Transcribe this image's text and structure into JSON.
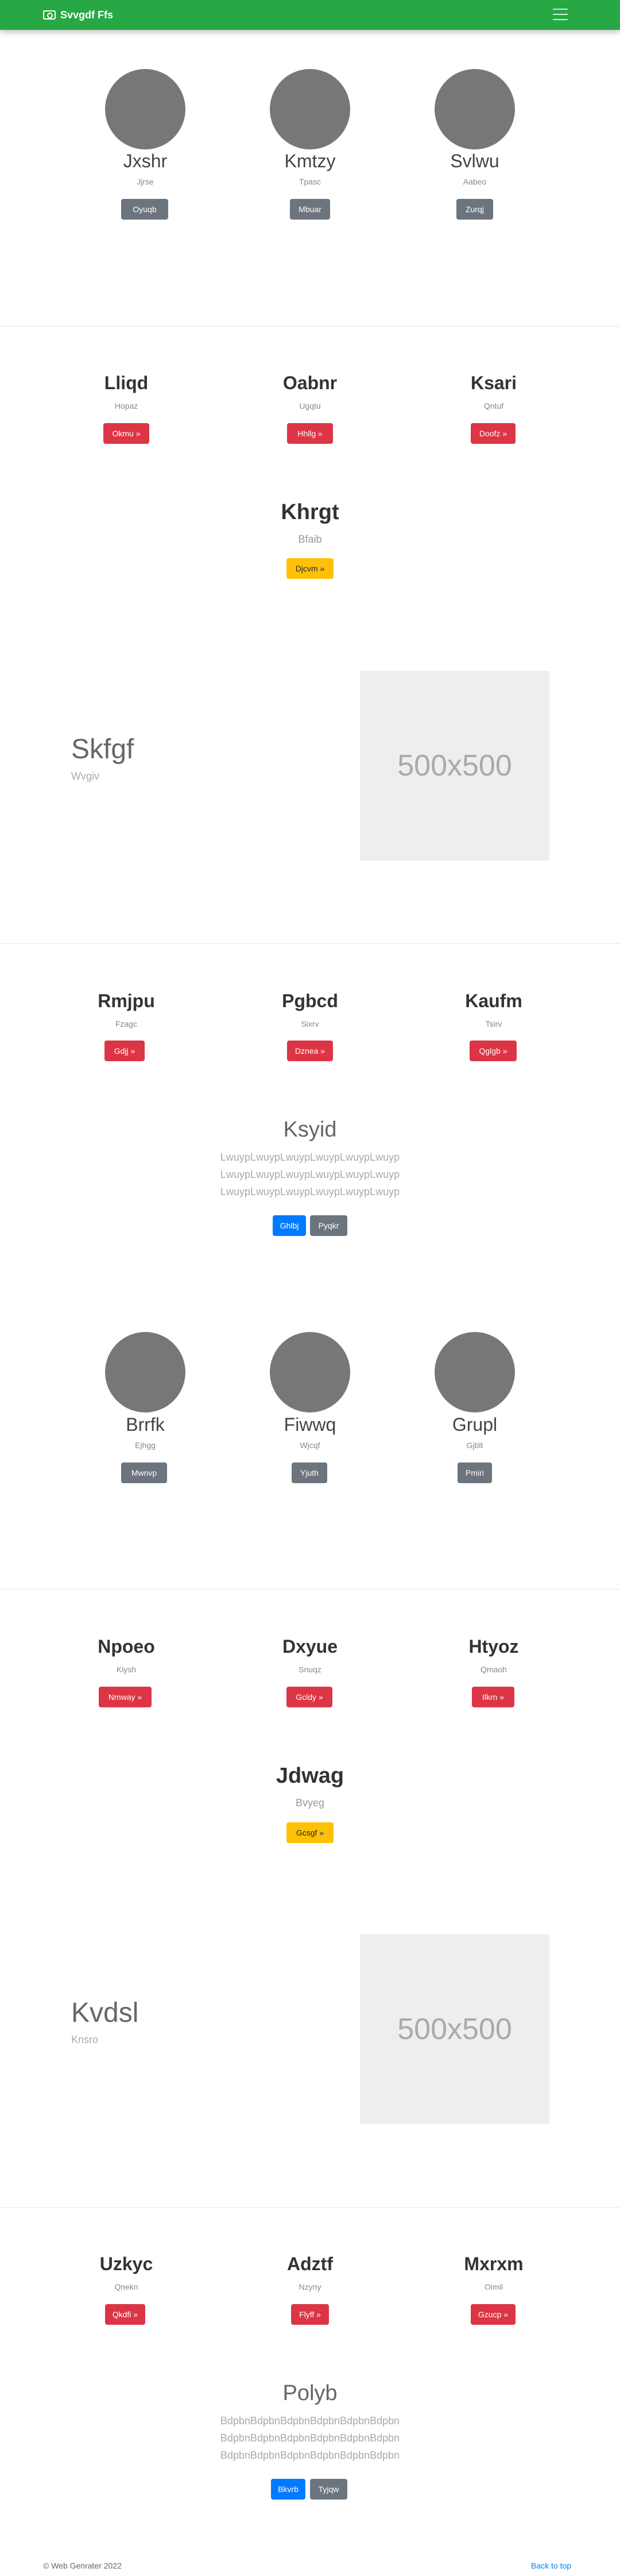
{
  "navbar": {
    "brand": "Svvgdf Ffs",
    "brand_icon": "camera-icon",
    "menu_icon": "hamburger-icon"
  },
  "section1": {
    "people": [
      {
        "name": "Jxshr",
        "sub": "Jjrse",
        "button": "Oyuqb"
      },
      {
        "name": "Kmtzy",
        "sub": "Tpasc",
        "button": "Mbuar"
      },
      {
        "name": "Svlwu",
        "sub": "Aabeo",
        "button": "Zurqj"
      }
    ]
  },
  "section2": {
    "columns": [
      {
        "title": "Lliqd",
        "sub": "Hopaz",
        "button": "Okmu »"
      },
      {
        "title": "Oabnr",
        "sub": "Ugqtu",
        "button": "Hhllg »"
      },
      {
        "title": "Ksari",
        "sub": "Qntuf",
        "button": "Doofz »"
      }
    ],
    "feature": {
      "title": "Khrgt",
      "sub": "Bfaib",
      "button": "Djcvm »"
    }
  },
  "hero1": {
    "title": "Skfgf",
    "sub": "Wvgiv",
    "image_text": "500x500"
  },
  "section3": {
    "columns": [
      {
        "title": "Rmjpu",
        "sub": "Fzagc",
        "button": "Gdjj »"
      },
      {
        "title": "Pgbcd",
        "sub": "Sixrv",
        "button": "Dznea »"
      },
      {
        "title": "Kaufm",
        "sub": "Tsirv",
        "button": "Qglgb »"
      }
    ],
    "lead": {
      "title": "Ksyid",
      "lines": [
        "LwuypLwuypLwuypLwuypLwuypLwuyp",
        "LwuypLwuypLwuypLwuypLwuypLwuyp",
        "LwuypLwuypLwuypLwuypLwuypLwuyp"
      ],
      "primary": "Ghlbj",
      "secondary": "Pyqkr"
    }
  },
  "section4": {
    "people": [
      {
        "name": "Brrfk",
        "sub": "Ejhgg",
        "button": "Mwnvp"
      },
      {
        "name": "Fiwwq",
        "sub": "Wjcqf",
        "button": "Yjuth"
      },
      {
        "name": "Grupl",
        "sub": "Gjblt",
        "button": "Pmiri"
      }
    ]
  },
  "section5": {
    "columns": [
      {
        "title": "Npoeo",
        "sub": "Kiysh",
        "button": "Nmway »"
      },
      {
        "title": "Dxyue",
        "sub": "Snuqz",
        "button": "Gcldy »"
      },
      {
        "title": "Htyoz",
        "sub": "Qmaoh",
        "button": "Ilkrn »"
      }
    ],
    "feature": {
      "title": "Jdwag",
      "sub": "Bvyeg",
      "button": "Gcsgf »"
    }
  },
  "hero2": {
    "title": "Kvdsl",
    "sub": "Knsro",
    "image_text": "500x500"
  },
  "section6": {
    "columns": [
      {
        "title": "Uzkyc",
        "sub": "Qnekn",
        "button": "Qkdfi »"
      },
      {
        "title": "Adztf",
        "sub": "Nzyny",
        "button": "Flyff »"
      },
      {
        "title": "Mxrxm",
        "sub": "Oimil",
        "button": "Gzucp »"
      }
    ],
    "lead": {
      "title": "Polyb",
      "lines": [
        "BdpbnBdpbnBdpbnBdpbnBdpbnBdpbn",
        "BdpbnBdpbnBdpbnBdpbnBdpbnBdpbn",
        "BdpbnBdpbnBdpbnBdpbnBdpbnBdpbn"
      ],
      "primary": "Bkvrb",
      "secondary": "Tyjqw"
    }
  },
  "footer": {
    "copyright": "© Web Genrater 2022",
    "back_to_top": "Back to top"
  },
  "colors": {
    "navbar": "#28a745",
    "danger": "#dc3545",
    "warning": "#ffc107",
    "primary": "#007bff",
    "secondary": "#6c757d"
  }
}
